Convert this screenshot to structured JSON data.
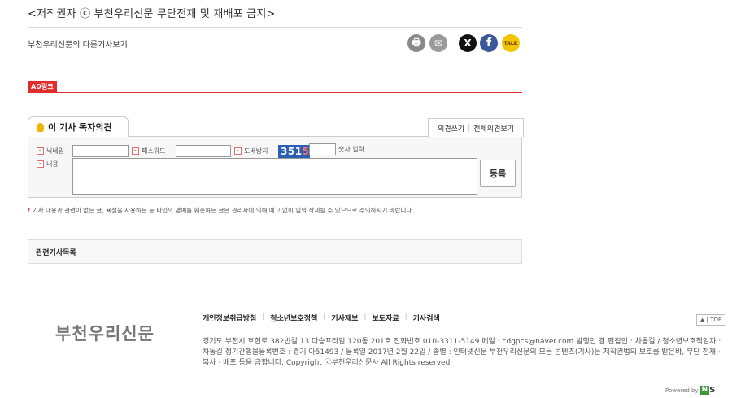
{
  "copyright": "<저작권자 ⓒ 부천우리신문 무단전재 및 재배포 금지>",
  "other_articles_link": "부천우리신문의 다른기사보기",
  "share_buttons": [
    {
      "name": "print",
      "icon": "print-icon",
      "glyph": "🖶",
      "color": "#8a8a8a"
    },
    {
      "name": "email",
      "icon": "email-icon",
      "glyph": "✉",
      "color": "#9a9a9a"
    },
    {
      "name": "x",
      "icon": "x-icon",
      "glyph": "X",
      "color": "#111111"
    },
    {
      "name": "facebook",
      "icon": "facebook-icon",
      "glyph": "f",
      "color": "#3b5998"
    },
    {
      "name": "kakaotalk",
      "icon": "kakaotalk-icon",
      "glyph": "TALK",
      "color": "#f5c400"
    }
  ],
  "ad_label": "AD링크",
  "comments": {
    "tab_title": "이 기사 독자의견",
    "write_link": "의견쓰기",
    "view_all_link": "전체의견보기",
    "separator": "|",
    "nickname_label": "닉네임",
    "password_label": "패스워드",
    "spam_label": "도배방지",
    "captcha_text": "351",
    "captcha_last": "5",
    "captcha_hint": "숫자 입력",
    "content_label": "내용",
    "submit_label": "등록",
    "notice": "기사 내용과 관련이 없는 글, 욕설을 사용하는 등 타인의 명예를 훼손하는 글은 관리자에 의해 예고 없이 임의 삭제될 수 있으므로 주의하시기 바랍니다."
  },
  "related_title": "관련기사목록",
  "footer": {
    "logo": "부천우리신문",
    "links": [
      "개인정보취급방침",
      "청소년보호정책",
      "기사제보",
      "보도자료",
      "기사검색"
    ],
    "top_label": "▲ | TOP",
    "info": "경기도 부천시 호현로 382번길 13 다승프라임 120동 201호 전화번호 010-3311-5149 메일 : cdgpcs@naver.com 발행인 겸 편집인 : 차동길 / 청소년보호책임자 : 차동길 정기간행물등록번호 : 경기 아51493 / 등록일 2017년 2월 22일 / 종별 : 인터넷신문 부천우리신문의 모든 콘텐츠(기사)는 저작권법의 보호를 받은바, 무단 전재 · 복사 · 배포 등을 금합니다. Copyright ⓒ부천우리신문사 All Rights reserved.",
    "powered_by": "Powered by",
    "powered_n": "N",
    "powered_s": "S"
  }
}
